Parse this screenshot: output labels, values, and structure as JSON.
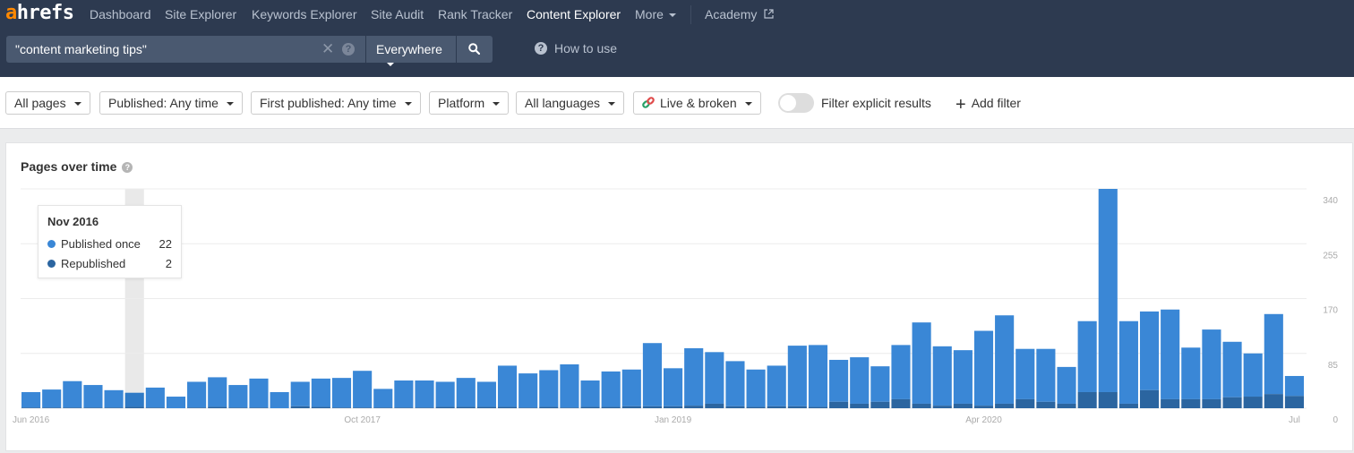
{
  "app": {
    "logo_a": "a",
    "logo_rest": "hrefs"
  },
  "nav": {
    "items": [
      {
        "label": "Dashboard",
        "active": false
      },
      {
        "label": "Site Explorer",
        "active": false
      },
      {
        "label": "Keywords Explorer",
        "active": false
      },
      {
        "label": "Site Audit",
        "active": false
      },
      {
        "label": "Rank Tracker",
        "active": false
      },
      {
        "label": "Content Explorer",
        "active": true
      },
      {
        "label": "More",
        "active": false
      }
    ],
    "academy": "Academy"
  },
  "search": {
    "value": "\"content marketing tips\"",
    "scope": "Everywhere",
    "how_to_use": "How to use"
  },
  "filters": {
    "all_pages": "All pages",
    "published": "Published: Any time",
    "first_published": "First published: Any time",
    "platform": "Platform",
    "languages": "All languages",
    "live_broken": "Live & broken",
    "explicit_label": "Filter explicit results",
    "explicit_on": false,
    "add_filter": "Add filter"
  },
  "card": {
    "title": "Pages over time"
  },
  "tooltip": {
    "title": "Nov 2016",
    "rows": [
      {
        "label": "Published once",
        "value": "22",
        "color": "#3a87d6"
      },
      {
        "label": "Republished",
        "value": "2",
        "color": "#2b65a0"
      }
    ]
  },
  "colors": {
    "published_once": "#3a87d6",
    "republished": "#2b65a0",
    "hover_band": "#e9e9e9"
  },
  "chart_data": {
    "type": "bar",
    "stacked": true,
    "title": "Pages over time",
    "x_tick_labels": [
      {
        "index": 0,
        "label": "Jun 2016"
      },
      {
        "index": 16,
        "label": "Oct 2017"
      },
      {
        "index": 31,
        "label": "Jan 2019"
      },
      {
        "index": 46,
        "label": "Apr 2020"
      },
      {
        "index": 61,
        "label": "Jul"
      }
    ],
    "y_ticks": [
      0,
      85,
      170,
      255,
      340
    ],
    "ylim": [
      0,
      340
    ],
    "grid": true,
    "y_axis_side": "right",
    "hover_index": 5,
    "categories": [
      "Jun 2016",
      "Jul 2016",
      "Aug 2016",
      "Sep 2016",
      "Oct 2016",
      "Nov 2016",
      "Dec 2016",
      "Jan 2017",
      "Feb 2017",
      "Mar 2017",
      "Apr 2017",
      "May 2017",
      "Jun 2017",
      "Jul 2017",
      "Aug 2017",
      "Sep 2017",
      "Oct 2017",
      "Nov 2017",
      "Dec 2017",
      "Jan 2018",
      "Feb 2018",
      "Mar 2018",
      "Apr 2018",
      "May 2018",
      "Jun 2018",
      "Jul 2018",
      "Aug 2018",
      "Sep 2018",
      "Oct 2018",
      "Nov 2018",
      "Dec 2018",
      "Jan 2019",
      "Feb 2019",
      "Mar 2019",
      "Apr 2019",
      "May 2019",
      "Jun 2019",
      "Jul 2019",
      "Aug 2019",
      "Sep 2019",
      "Oct 2019",
      "Nov 2019",
      "Dec 2019",
      "Jan 2020",
      "Feb 2020",
      "Mar 2020",
      "Apr 2020",
      "May 2020",
      "Jun 2020",
      "Jul 2020",
      "Aug 2020",
      "Sep 2020",
      "Oct 2020",
      "Nov 2020",
      "Dec 2020",
      "Jan 2021",
      "Feb 2021",
      "Mar 2021",
      "Apr 2021",
      "May 2021",
      "Jun 2021",
      "Jul 2021"
    ],
    "series": [
      {
        "name": "Republished",
        "values": [
          1,
          1,
          1,
          1,
          1,
          2,
          1,
          0,
          1,
          2,
          1,
          1,
          0,
          3,
          2,
          1,
          1,
          1,
          1,
          1,
          2,
          2,
          2,
          2,
          1,
          2,
          1,
          2,
          2,
          3,
          3,
          3,
          4,
          7,
          3,
          2,
          3,
          3,
          2,
          10,
          7,
          10,
          14,
          7,
          4,
          7,
          4,
          7,
          14,
          10,
          7,
          25,
          25,
          7,
          28,
          14,
          14,
          14,
          17,
          18,
          22,
          19
        ]
      },
      {
        "name": "Published once",
        "values": [
          24,
          28,
          41,
          35,
          27,
          22,
          31,
          18,
          40,
          46,
          35,
          45,
          25,
          38,
          44,
          46,
          57,
          29,
          42,
          42,
          39,
          45,
          39,
          64,
          53,
          57,
          67,
          41,
          55,
          57,
          98,
          59,
          89,
          80,
          70,
          58,
          63,
          94,
          96,
          65,
          72,
          55,
          84,
          126,
          92,
          83,
          116,
          137,
          78,
          82,
          57,
          110,
          315,
          128,
          122,
          139,
          80,
          108,
          86,
          67,
          124,
          31
        ]
      }
    ]
  }
}
